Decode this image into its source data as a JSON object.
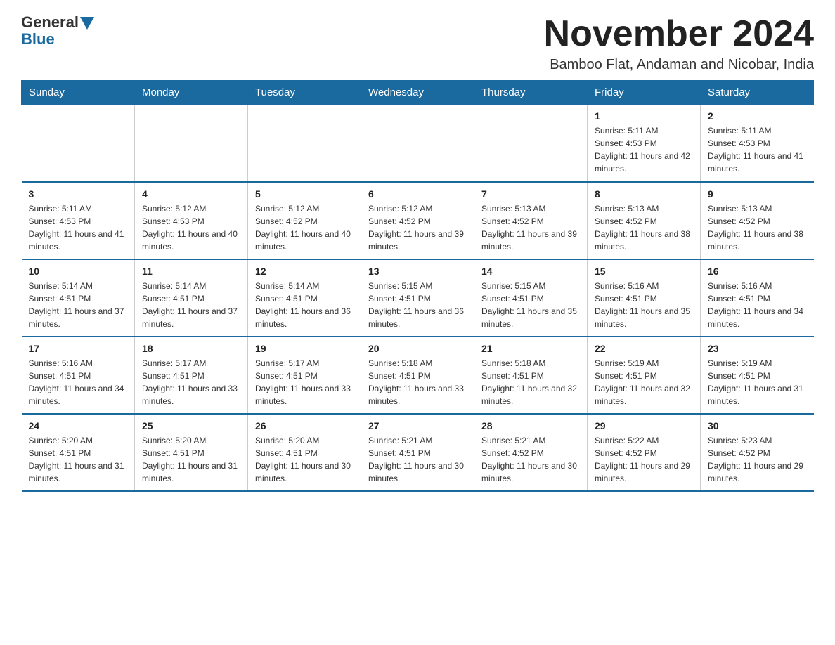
{
  "logo": {
    "general": "General",
    "blue": "Blue"
  },
  "header": {
    "month_year": "November 2024",
    "location": "Bamboo Flat, Andaman and Nicobar, India"
  },
  "days_of_week": [
    "Sunday",
    "Monday",
    "Tuesday",
    "Wednesday",
    "Thursday",
    "Friday",
    "Saturday"
  ],
  "weeks": [
    [
      {
        "day": "",
        "sunrise": "",
        "sunset": "",
        "daylight": ""
      },
      {
        "day": "",
        "sunrise": "",
        "sunset": "",
        "daylight": ""
      },
      {
        "day": "",
        "sunrise": "",
        "sunset": "",
        "daylight": ""
      },
      {
        "day": "",
        "sunrise": "",
        "sunset": "",
        "daylight": ""
      },
      {
        "day": "",
        "sunrise": "",
        "sunset": "",
        "daylight": ""
      },
      {
        "day": "1",
        "sunrise": "Sunrise: 5:11 AM",
        "sunset": "Sunset: 4:53 PM",
        "daylight": "Daylight: 11 hours and 42 minutes."
      },
      {
        "day": "2",
        "sunrise": "Sunrise: 5:11 AM",
        "sunset": "Sunset: 4:53 PM",
        "daylight": "Daylight: 11 hours and 41 minutes."
      }
    ],
    [
      {
        "day": "3",
        "sunrise": "Sunrise: 5:11 AM",
        "sunset": "Sunset: 4:53 PM",
        "daylight": "Daylight: 11 hours and 41 minutes."
      },
      {
        "day": "4",
        "sunrise": "Sunrise: 5:12 AM",
        "sunset": "Sunset: 4:53 PM",
        "daylight": "Daylight: 11 hours and 40 minutes."
      },
      {
        "day": "5",
        "sunrise": "Sunrise: 5:12 AM",
        "sunset": "Sunset: 4:52 PM",
        "daylight": "Daylight: 11 hours and 40 minutes."
      },
      {
        "day": "6",
        "sunrise": "Sunrise: 5:12 AM",
        "sunset": "Sunset: 4:52 PM",
        "daylight": "Daylight: 11 hours and 39 minutes."
      },
      {
        "day": "7",
        "sunrise": "Sunrise: 5:13 AM",
        "sunset": "Sunset: 4:52 PM",
        "daylight": "Daylight: 11 hours and 39 minutes."
      },
      {
        "day": "8",
        "sunrise": "Sunrise: 5:13 AM",
        "sunset": "Sunset: 4:52 PM",
        "daylight": "Daylight: 11 hours and 38 minutes."
      },
      {
        "day": "9",
        "sunrise": "Sunrise: 5:13 AM",
        "sunset": "Sunset: 4:52 PM",
        "daylight": "Daylight: 11 hours and 38 minutes."
      }
    ],
    [
      {
        "day": "10",
        "sunrise": "Sunrise: 5:14 AM",
        "sunset": "Sunset: 4:51 PM",
        "daylight": "Daylight: 11 hours and 37 minutes."
      },
      {
        "day": "11",
        "sunrise": "Sunrise: 5:14 AM",
        "sunset": "Sunset: 4:51 PM",
        "daylight": "Daylight: 11 hours and 37 minutes."
      },
      {
        "day": "12",
        "sunrise": "Sunrise: 5:14 AM",
        "sunset": "Sunset: 4:51 PM",
        "daylight": "Daylight: 11 hours and 36 minutes."
      },
      {
        "day": "13",
        "sunrise": "Sunrise: 5:15 AM",
        "sunset": "Sunset: 4:51 PM",
        "daylight": "Daylight: 11 hours and 36 minutes."
      },
      {
        "day": "14",
        "sunrise": "Sunrise: 5:15 AM",
        "sunset": "Sunset: 4:51 PM",
        "daylight": "Daylight: 11 hours and 35 minutes."
      },
      {
        "day": "15",
        "sunrise": "Sunrise: 5:16 AM",
        "sunset": "Sunset: 4:51 PM",
        "daylight": "Daylight: 11 hours and 35 minutes."
      },
      {
        "day": "16",
        "sunrise": "Sunrise: 5:16 AM",
        "sunset": "Sunset: 4:51 PM",
        "daylight": "Daylight: 11 hours and 34 minutes."
      }
    ],
    [
      {
        "day": "17",
        "sunrise": "Sunrise: 5:16 AM",
        "sunset": "Sunset: 4:51 PM",
        "daylight": "Daylight: 11 hours and 34 minutes."
      },
      {
        "day": "18",
        "sunrise": "Sunrise: 5:17 AM",
        "sunset": "Sunset: 4:51 PM",
        "daylight": "Daylight: 11 hours and 33 minutes."
      },
      {
        "day": "19",
        "sunrise": "Sunrise: 5:17 AM",
        "sunset": "Sunset: 4:51 PM",
        "daylight": "Daylight: 11 hours and 33 minutes."
      },
      {
        "day": "20",
        "sunrise": "Sunrise: 5:18 AM",
        "sunset": "Sunset: 4:51 PM",
        "daylight": "Daylight: 11 hours and 33 minutes."
      },
      {
        "day": "21",
        "sunrise": "Sunrise: 5:18 AM",
        "sunset": "Sunset: 4:51 PM",
        "daylight": "Daylight: 11 hours and 32 minutes."
      },
      {
        "day": "22",
        "sunrise": "Sunrise: 5:19 AM",
        "sunset": "Sunset: 4:51 PM",
        "daylight": "Daylight: 11 hours and 32 minutes."
      },
      {
        "day": "23",
        "sunrise": "Sunrise: 5:19 AM",
        "sunset": "Sunset: 4:51 PM",
        "daylight": "Daylight: 11 hours and 31 minutes."
      }
    ],
    [
      {
        "day": "24",
        "sunrise": "Sunrise: 5:20 AM",
        "sunset": "Sunset: 4:51 PM",
        "daylight": "Daylight: 11 hours and 31 minutes."
      },
      {
        "day": "25",
        "sunrise": "Sunrise: 5:20 AM",
        "sunset": "Sunset: 4:51 PM",
        "daylight": "Daylight: 11 hours and 31 minutes."
      },
      {
        "day": "26",
        "sunrise": "Sunrise: 5:20 AM",
        "sunset": "Sunset: 4:51 PM",
        "daylight": "Daylight: 11 hours and 30 minutes."
      },
      {
        "day": "27",
        "sunrise": "Sunrise: 5:21 AM",
        "sunset": "Sunset: 4:51 PM",
        "daylight": "Daylight: 11 hours and 30 minutes."
      },
      {
        "day": "28",
        "sunrise": "Sunrise: 5:21 AM",
        "sunset": "Sunset: 4:52 PM",
        "daylight": "Daylight: 11 hours and 30 minutes."
      },
      {
        "day": "29",
        "sunrise": "Sunrise: 5:22 AM",
        "sunset": "Sunset: 4:52 PM",
        "daylight": "Daylight: 11 hours and 29 minutes."
      },
      {
        "day": "30",
        "sunrise": "Sunrise: 5:23 AM",
        "sunset": "Sunset: 4:52 PM",
        "daylight": "Daylight: 11 hours and 29 minutes."
      }
    ]
  ]
}
